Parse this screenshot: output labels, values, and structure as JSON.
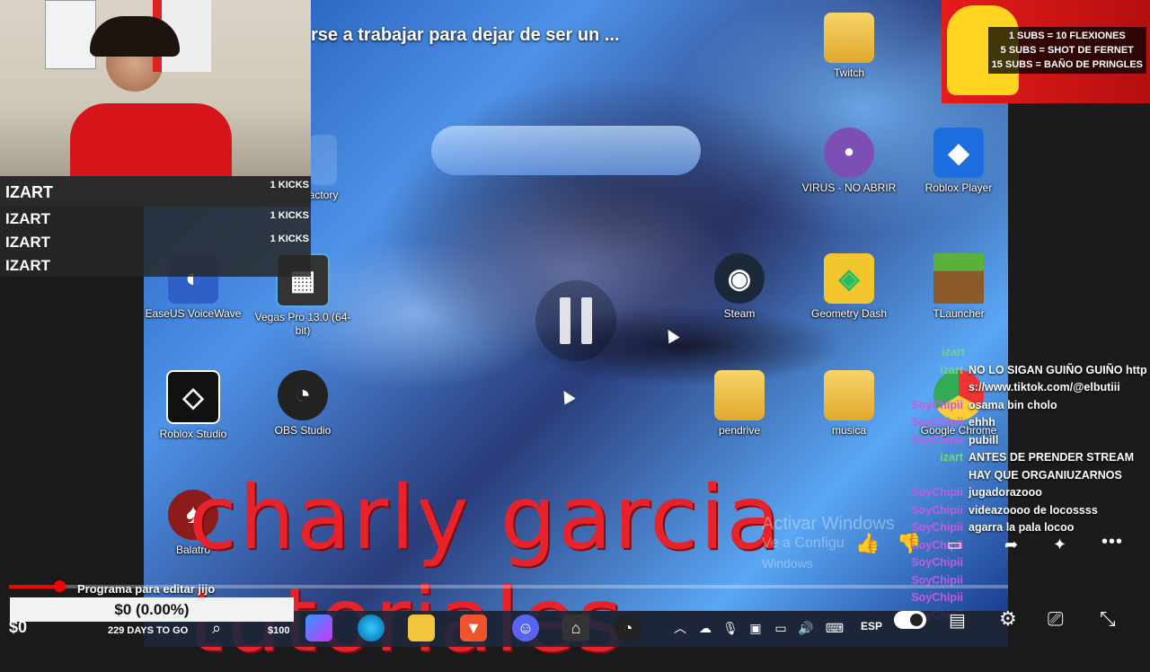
{
  "video": {
    "title": "rse a trabajar para dejar de ser un ...",
    "overlay_text": "charly garcia tutoriales",
    "watermark_line1": "Activar Windows",
    "watermark_line2": "Ve a Configu",
    "watermark_line3": "Windows",
    "chapter_label": "Programa para editar jijo",
    "progress_fraction": 0.05
  },
  "desktop_icons": [
    {
      "label": "Twitch",
      "kind": "folder"
    },
    {
      "label": "VIRUS - NO ABRIR",
      "kind": "purple"
    },
    {
      "label": "Roblox Player",
      "kind": "roblox"
    },
    {
      "label": "actory",
      "kind": "partial"
    },
    {
      "label": "EaseUS VoiceWave",
      "kind": "app"
    },
    {
      "label": "Vegas Pro 13.0 (64-bit)",
      "kind": "app"
    },
    {
      "label": "Steam",
      "kind": "steam"
    },
    {
      "label": "Geometry Dash",
      "kind": "gd"
    },
    {
      "label": "TLauncher",
      "kind": "mc"
    },
    {
      "label": "Roblox Studio",
      "kind": "studio"
    },
    {
      "label": "OBS Studio",
      "kind": "obs"
    },
    {
      "label": "pendrive",
      "kind": "folder"
    },
    {
      "label": "musica",
      "kind": "folder"
    },
    {
      "label": "Google Chrome",
      "kind": "chrome"
    },
    {
      "label": "Balatro",
      "kind": "balatro"
    }
  ],
  "kicks": [
    {
      "name": "IZART",
      "count": "1 KICKS"
    },
    {
      "name": "IZART",
      "count": "1 KICKS"
    },
    {
      "name": "IZART",
      "count": "1 KICKS"
    },
    {
      "name": "IZART",
      "count": ""
    }
  ],
  "subs_goals": {
    "line1": "1 SUBS = 10 FLEXIONES",
    "line2": "5 SUBS = SHOT DE FERNET",
    "line3": "15 SUBS = BAÑO DE PRINGLES"
  },
  "chat": [
    {
      "user": "izart",
      "text": ""
    },
    {
      "user": "izart",
      "text": "NO LO SIGAN GUIÑO GUIÑO https://www.tiktok.com/@elbutiii"
    },
    {
      "user": "SoyChipii",
      "text": "osama bin cholo"
    },
    {
      "user": "SoyChipii",
      "text": "ehhh"
    },
    {
      "user": "SoyChipii",
      "text": "pubill"
    },
    {
      "user": "izart",
      "text": "ANTES DE PRENDER STREAM HAY QUE ORGANIUZARNOS"
    },
    {
      "user": "SoyChipii",
      "text": "jugadorazooo"
    },
    {
      "user": "SoyChipii",
      "text": "videazoooo de locossss"
    },
    {
      "user": "SoyChipii",
      "text": "agarra la pala locoo"
    },
    {
      "user": "SoyChipii",
      "text": ""
    },
    {
      "user": "SoyChipii",
      "text": ""
    },
    {
      "user": "SoyChipii",
      "text": ""
    },
    {
      "user": "SoyChipii",
      "text": ""
    },
    {
      "user": "SoyChipii",
      "text": ""
    }
  ],
  "donation": {
    "amount": "$0 (0.00%)",
    "dollar": "$0",
    "days": "229 DAYS TO GO",
    "goal": "$100"
  },
  "taskbar": {
    "lang": "ESP"
  },
  "icons": {
    "like": "thumbs-up-icon",
    "dislike": "thumbs-down-icon",
    "captions": "captions-icon",
    "share": "share-icon",
    "more": "more-icon",
    "settings": "gear-icon",
    "cast": "cast-icon",
    "exit_fullscreen": "exit-fullscreen-icon"
  }
}
